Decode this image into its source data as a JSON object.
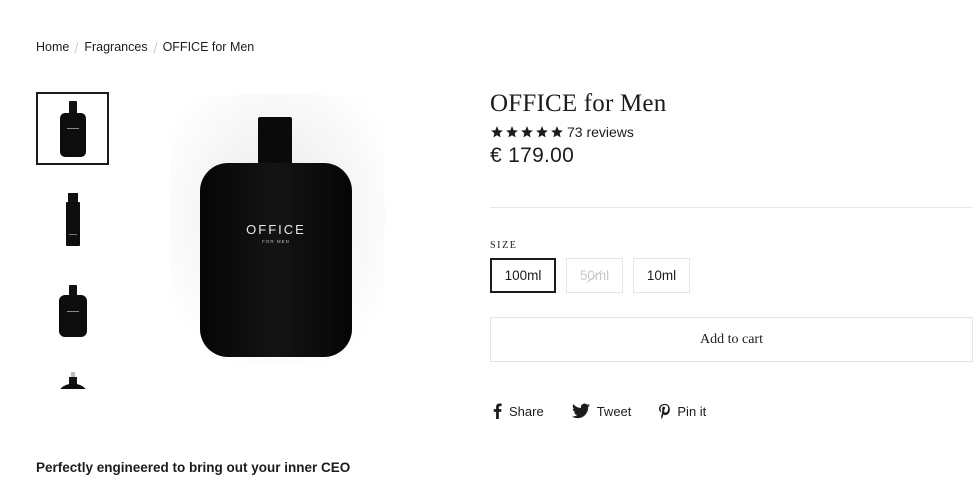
{
  "breadcrumb": {
    "home": "Home",
    "category": "Fragrances",
    "current": "OFFICE for Men"
  },
  "product": {
    "title": "OFFICE for Men",
    "rating_stars": 5,
    "reviews": "73 reviews",
    "price": "€ 179.00",
    "bottle_brand": "OFFICE",
    "bottle_sub": "FOR MEN"
  },
  "size": {
    "label": "SIZE",
    "options": [
      {
        "label": "100ml",
        "state": "selected"
      },
      {
        "label": "50ml",
        "state": "unavailable"
      },
      {
        "label": "10ml",
        "state": "available"
      }
    ]
  },
  "cart": {
    "add_label": "Add to cart"
  },
  "social": {
    "share": "Share",
    "tweet": "Tweet",
    "pin": "Pin it"
  },
  "description": {
    "tagline": "Perfectly engineered to bring out your inner CEO"
  }
}
